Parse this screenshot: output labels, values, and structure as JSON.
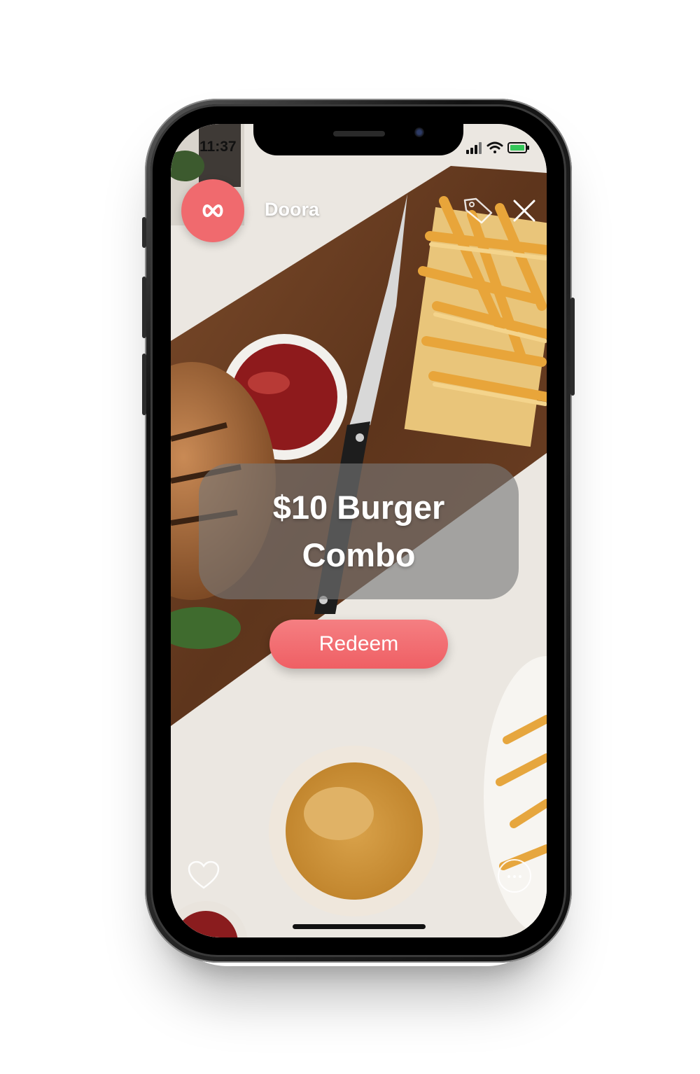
{
  "status_bar": {
    "time": "11:37"
  },
  "header": {
    "brand_name": "Doora",
    "logo_icon": "infinity-icon",
    "tag_icon": "tag-icon",
    "close_icon": "close-icon"
  },
  "offer": {
    "title": "$10 Burger Combo"
  },
  "actions": {
    "redeem_label": "Redeem",
    "heart_icon": "heart-icon",
    "more_icon": "more-icon"
  },
  "colors": {
    "accent": "#f06a6e",
    "card": "#787878",
    "board": "#6b3f22"
  }
}
